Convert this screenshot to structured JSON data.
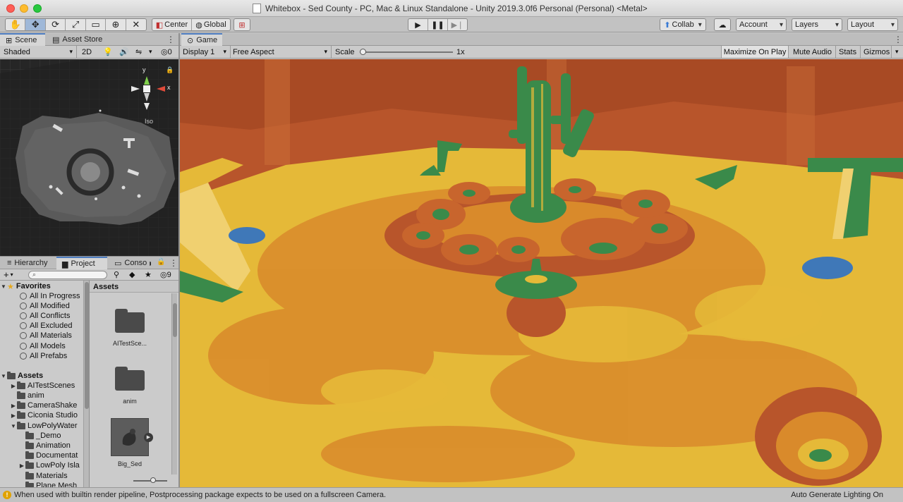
{
  "window": {
    "title": "Whitebox - Sed County - PC, Mac & Linux Standalone - Unity 2019.3.0f6 Personal (Personal) <Metal>"
  },
  "toolbar": {
    "tools": [
      "hand-tool-icon",
      "move-tool-icon",
      "rotate-tool-icon",
      "scale-tool-icon",
      "rect-tool-icon",
      "transform-tool-icon",
      "custom-tool-icon"
    ],
    "pivot_label": "Center",
    "space_label": "Global",
    "collab_label": "Collab",
    "account_label": "Account",
    "layers_label": "Layers",
    "layout_label": "Layout"
  },
  "scene_panel": {
    "tabs": [
      "Scene",
      "Asset Store"
    ],
    "shading_mode": "Shaded",
    "mode_2d": "2D",
    "hidden_count": "0",
    "gizmo_y": "y",
    "gizmo_x": "x",
    "projection": "Iso"
  },
  "game_panel": {
    "tab": "Game",
    "display": "Display 1",
    "aspect": "Free Aspect",
    "scale_label": "Scale",
    "scale_value": 0.0,
    "scale_text": "1x",
    "maximize_label": "Maximize On Play",
    "mute_label": "Mute Audio",
    "stats_label": "Stats",
    "gizmos_label": "Gizmos"
  },
  "project_panel": {
    "tabs": [
      "Hierarchy",
      "Project",
      "Conso"
    ],
    "hidden_packages": "9",
    "favorites_header": "Favorites",
    "favorites": [
      "All In Progress",
      "All Modified",
      "All Conflicts",
      "All Excluded",
      "All Materials",
      "All Models",
      "All Prefabs"
    ],
    "assets_header": "Assets",
    "asset_tree": [
      "AITestScenes",
      "anim",
      "CameraShake",
      "Ciconia Studio",
      "LowPolyWater"
    ],
    "lowpoly_children": [
      "_Demo",
      "Animation",
      "Documentat",
      "LowPoly Isla",
      "Materials",
      "Plane Mesh"
    ],
    "breadcrumb": "Assets",
    "grid_items": [
      "AITestSce...",
      "anim",
      "Big_Sed"
    ]
  },
  "status": {
    "message": "When used with builtin render pipeline, Postprocessing package expects to be used on a fullscreen Camera.",
    "lighting": "Auto Generate Lighting On"
  },
  "colors": {
    "accent": "#4c7cc0",
    "sand": "#e5b938",
    "sand_dark": "#d98a2b",
    "cliff": "#b8552b",
    "cactus": "#3a8a4a",
    "water": "#3f78b8"
  }
}
